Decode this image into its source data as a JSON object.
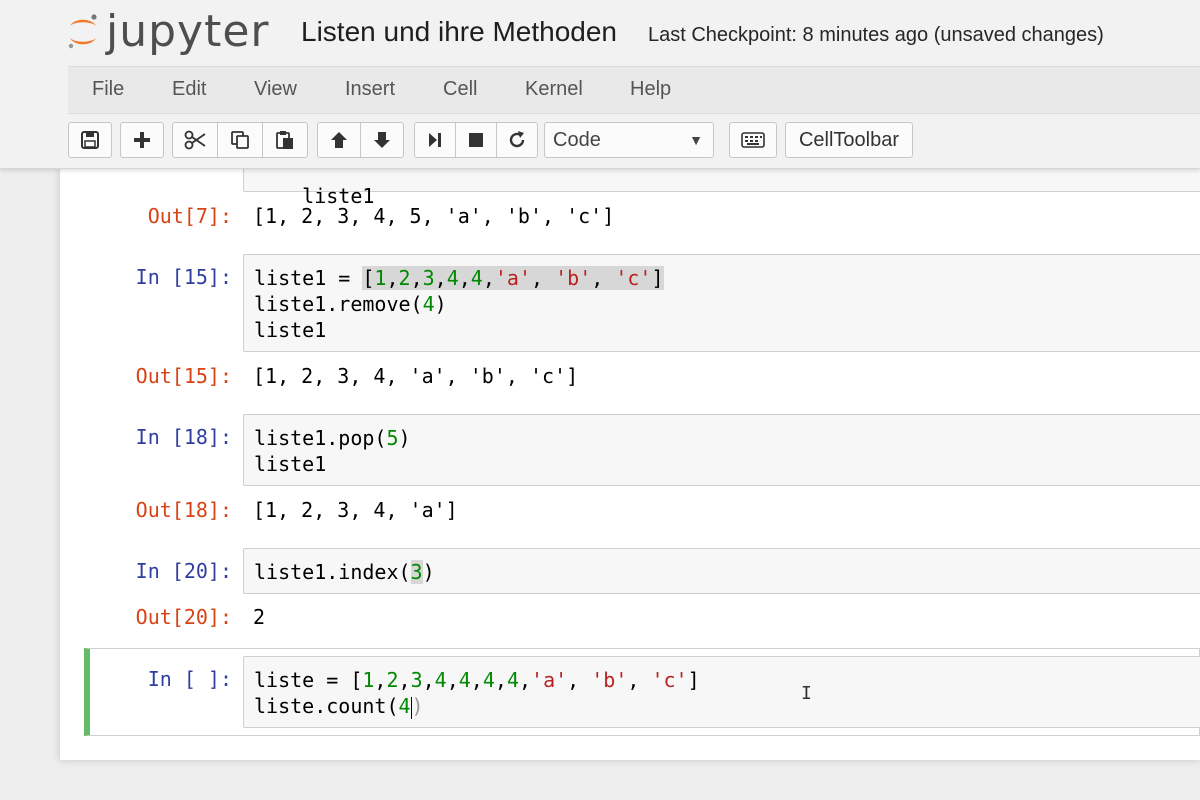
{
  "header": {
    "logo_text": "jupyter",
    "notebook_title": "Listen und ihre Methoden",
    "checkpoint": "Last Checkpoint: 8 minutes ago (unsaved changes)"
  },
  "menu": [
    "File",
    "Edit",
    "View",
    "Insert",
    "Cell",
    "Kernel",
    "Help"
  ],
  "toolbar": {
    "cell_type": "Code",
    "celltoolbar_label": "CellToolbar",
    "buttons": [
      "save-icon",
      "plus-icon",
      "cut-icon",
      "copy-icon",
      "paste-icon",
      "arrow-up-icon",
      "arrow-down-icon",
      "run-icon",
      "stop-icon",
      "restart-icon",
      "keyboard-icon"
    ]
  },
  "cells": {
    "c7": {
      "partial_input": "liste1",
      "out_prompt": "Out[7]:",
      "output": "[1, 2, 3, 4, 5, 'a', 'b', 'c']"
    },
    "c15": {
      "in_prompt": "In [15]:",
      "t1": "liste1 = ",
      "list": [
        "[",
        "1",
        ",",
        "2",
        ",",
        "3",
        ",",
        "4",
        ",",
        "4",
        ",",
        "'a'",
        ", ",
        "'b'",
        ", ",
        "'c'",
        "]"
      ],
      "line2_a": "liste1.remove(",
      "line2_num": "4",
      "line2_b": ")",
      "line3": "liste1",
      "out_prompt": "Out[15]:",
      "output": "[1, 2, 3, 4, 'a', 'b', 'c']"
    },
    "c18": {
      "in_prompt": "In [18]:",
      "line1_a": "liste1.pop(",
      "line1_num": "5",
      "line1_b": ")",
      "line2": "liste1",
      "out_prompt": "Out[18]:",
      "output": "[1, 2, 3, 4, 'a']"
    },
    "c20": {
      "in_prompt": "In [20]:",
      "line1_a": "liste1.index(",
      "line1_num": "3",
      "line1_b": ")",
      "out_prompt": "Out[20]:",
      "output": "2"
    },
    "c_new": {
      "in_prompt": "In [ ]:",
      "t1": "liste = ",
      "list": [
        "[",
        "1",
        ",",
        "2",
        ",",
        "3",
        ",",
        "4",
        ",",
        "4",
        ",",
        "4",
        ",",
        "4",
        ",",
        "'a'",
        ", ",
        "'b'",
        ", ",
        "'c'",
        "]"
      ],
      "line2_a": "liste.count(",
      "line2_num": "4",
      "line2_b": ")"
    }
  },
  "colors": {
    "in_prompt": "#303f9f",
    "out_prompt": "#d84315",
    "number": "#008800",
    "string": "#ba2121",
    "selected_border": "#66bb6a"
  }
}
